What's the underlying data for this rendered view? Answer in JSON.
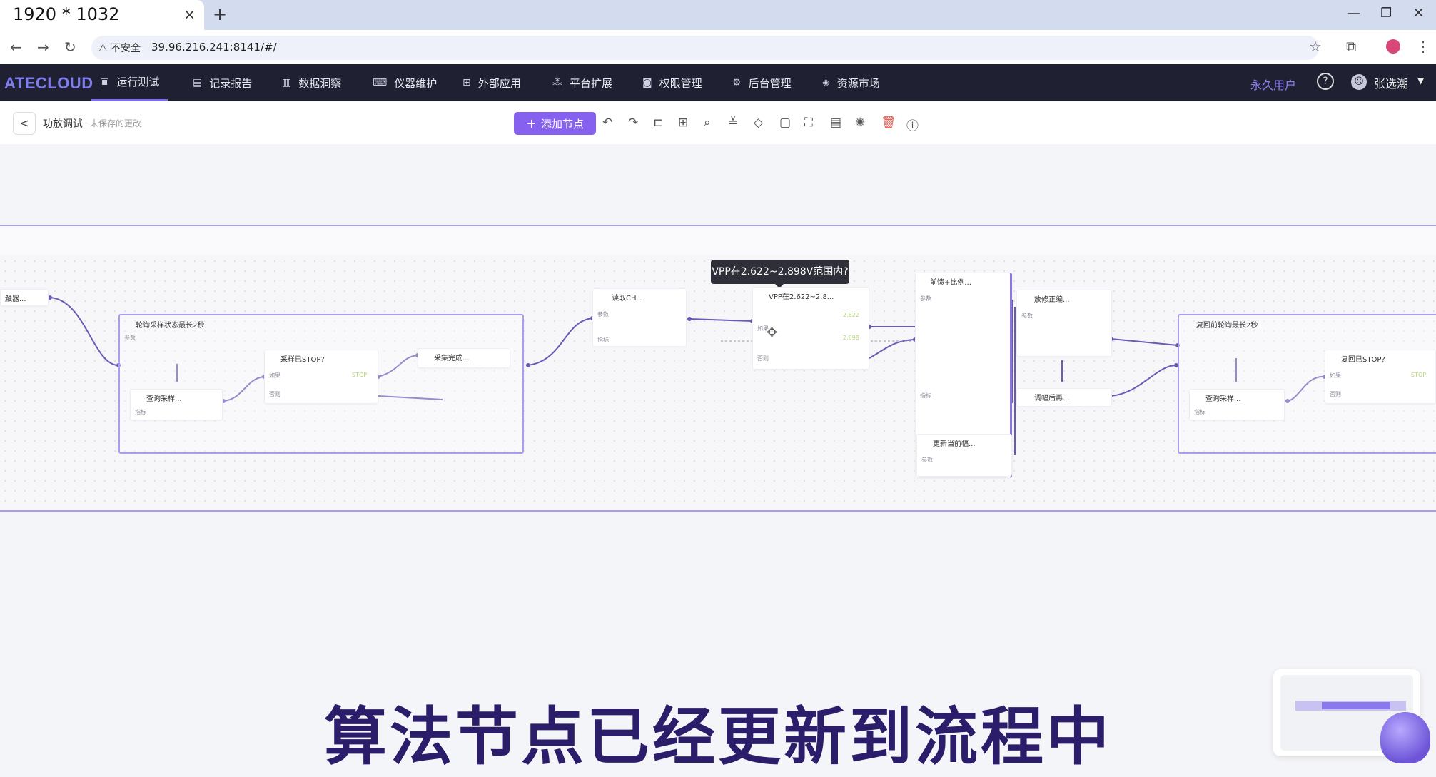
{
  "browser": {
    "tab_title": "1920 * 1032",
    "tab_close": "×",
    "new_tab": "+",
    "security_label": "⚠ 不安全",
    "url": "39.96.216.241:8141/#/"
  },
  "header": {
    "logo": "ATECLOUD",
    "nav": [
      {
        "label": "运行测试",
        "icon": "monitor-icon"
      },
      {
        "label": "记录报告",
        "icon": "clipboard-icon"
      },
      {
        "label": "数据洞察",
        "icon": "chart-icon"
      },
      {
        "label": "仪器维护",
        "icon": "keyboard-icon"
      },
      {
        "label": "外部应用",
        "icon": "grid-icon"
      },
      {
        "label": "平台扩展",
        "icon": "cluster-icon"
      },
      {
        "label": "权限管理",
        "icon": "robot-icon"
      },
      {
        "label": "后台管理",
        "icon": "gears-icon"
      },
      {
        "label": "资源市场",
        "icon": "tag-icon"
      }
    ],
    "user_type": "永久用户",
    "help": "?",
    "username": "张选潮"
  },
  "toolbar": {
    "back": "<",
    "flow_name": "功放调试",
    "unsaved": "未保存的更改",
    "add_node": "添加节点"
  },
  "canvas": {
    "tooltip": "VPP在2.622~2.898V范围内?",
    "group_left": "轮询采样状态最长2秒",
    "group_right": "复回前轮询最长2秒",
    "nodes": {
      "left_stub": "触器...",
      "query_sample": "查询采样...",
      "sample_stop": "采样已STOP?",
      "sample_done": "采集完成...",
      "read_ch": "读取CH...",
      "vpp_range": "VPP在2.622~2.8...",
      "pre_compare": "前馈+比例...",
      "amp_fix": "放修正编...",
      "adjust_after": "调幅后再...",
      "update_current": "更新当前幅...",
      "query_sample_r": "查询采样...",
      "restore_stop": "复回已STOP?"
    },
    "labels": {
      "param": "参数",
      "indicator": "指标",
      "if": "如果",
      "else": "否则",
      "low": "2.622",
      "high": "2.898",
      "stop": "STOP"
    }
  },
  "subtitle": "算法节点已经更新到流程中"
}
